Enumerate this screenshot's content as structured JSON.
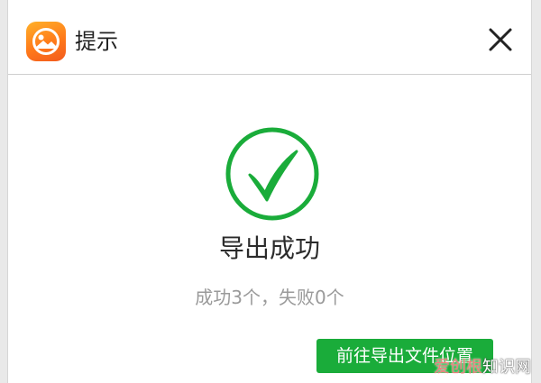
{
  "dialog": {
    "title": "提示",
    "app_icon": "photo-app-icon",
    "close_icon": "close-icon"
  },
  "content": {
    "status_icon": "checkmark-circle-icon",
    "message": "导出成功",
    "detail": "成功3个，失败0个",
    "open_button_label": "前往导出文件位置"
  },
  "watermark": {
    "part_a": "爱创根",
    "part_b": "知识网"
  },
  "colors": {
    "accent_green": "#1aac3a",
    "app_icon_orange": "#ff7a1a"
  }
}
